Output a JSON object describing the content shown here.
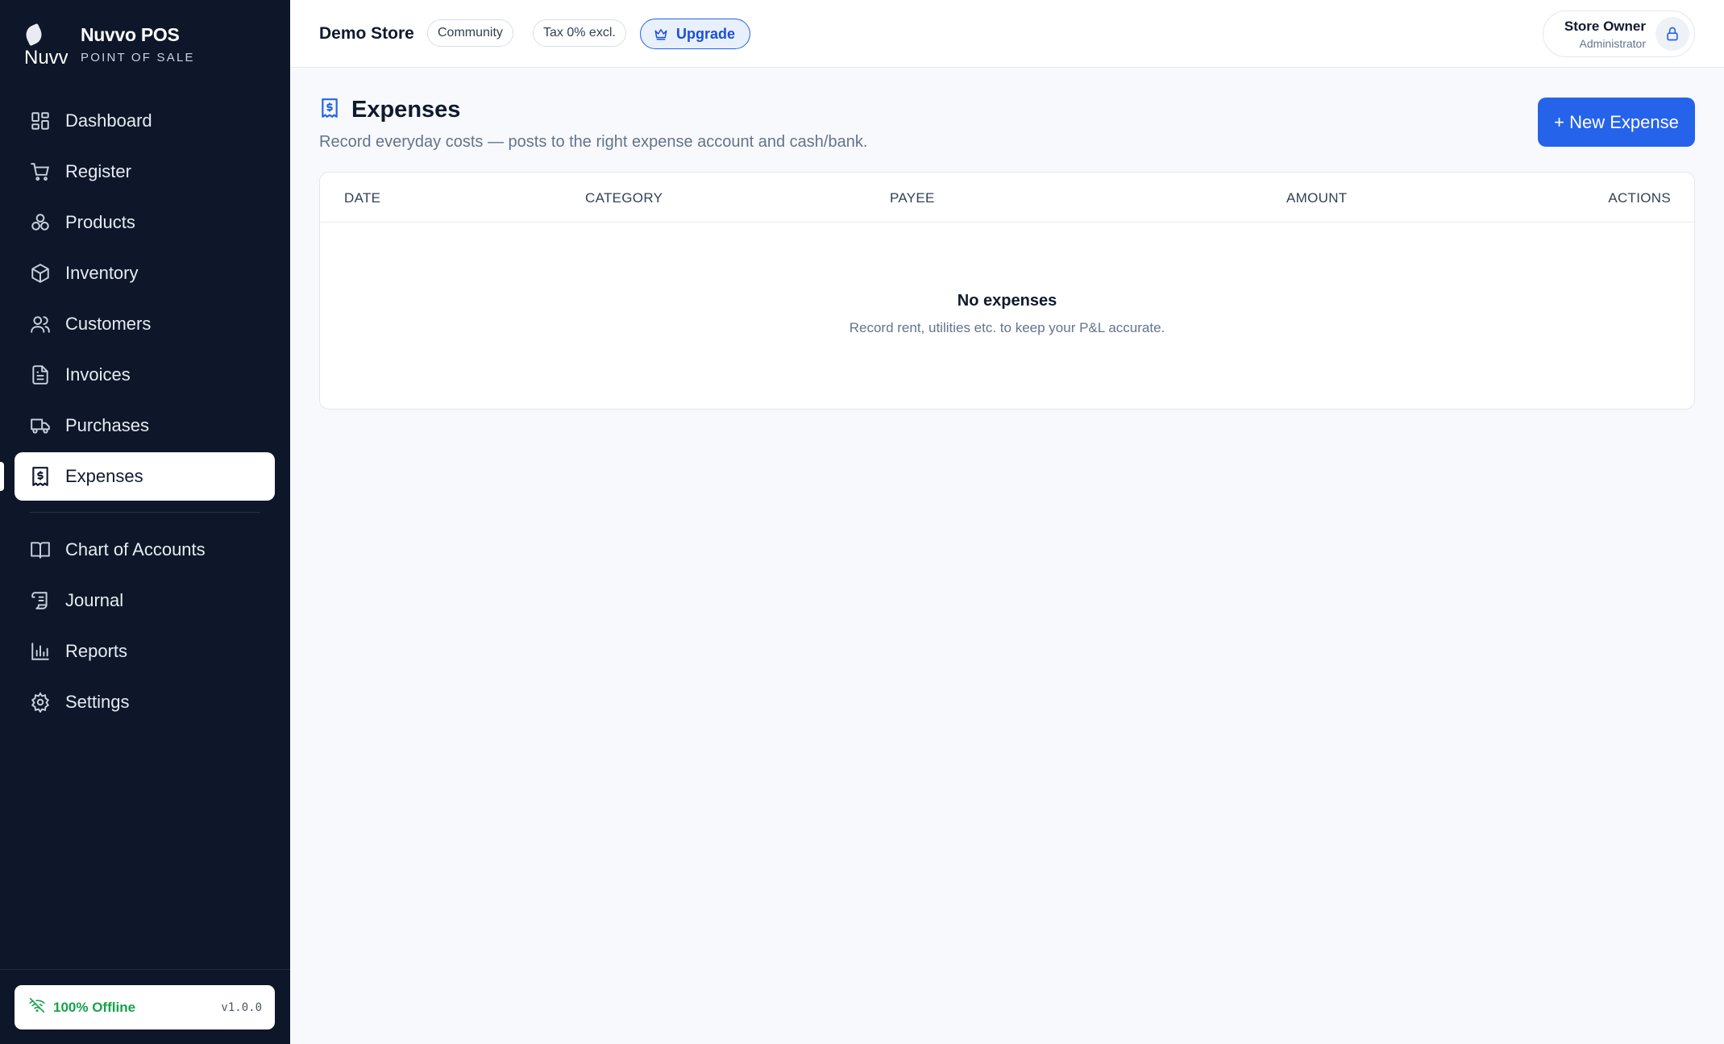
{
  "brand": {
    "logo_text": "Nuvv",
    "name": "Nuvvo POS",
    "subtitle": "POINT OF SALE"
  },
  "sidebar": {
    "items": [
      {
        "label": "Dashboard",
        "icon": "dashboard-icon"
      },
      {
        "label": "Register",
        "icon": "cart-icon"
      },
      {
        "label": "Products",
        "icon": "products-icon"
      },
      {
        "label": "Inventory",
        "icon": "box-icon"
      },
      {
        "label": "Customers",
        "icon": "users-icon"
      },
      {
        "label": "Invoices",
        "icon": "document-icon"
      },
      {
        "label": "Purchases",
        "icon": "truck-icon"
      },
      {
        "label": "Expenses",
        "icon": "receipt-dollar-icon",
        "active": true
      }
    ],
    "accounting_items": [
      {
        "label": "Chart of Accounts",
        "icon": "book-icon"
      },
      {
        "label": "Journal",
        "icon": "scroll-icon"
      },
      {
        "label": "Reports",
        "icon": "bar-chart-icon"
      },
      {
        "label": "Settings",
        "icon": "gear-icon"
      }
    ],
    "footer": {
      "status": "100% Offline",
      "version": "v1.0.0",
      "icon": "wifi-off-icon"
    }
  },
  "topbar": {
    "store": "Demo Store",
    "plan_chip": "Community",
    "tax_chip": "Tax 0% excl.",
    "upgrade_label": "Upgrade",
    "user_name": "Store Owner",
    "user_role": "Administrator"
  },
  "page": {
    "title": "Expenses",
    "subtitle": "Record everyday costs — posts to the right expense account and cash/bank.",
    "new_button": "+ New Expense"
  },
  "table": {
    "columns": [
      "DATE",
      "CATEGORY",
      "PAYEE",
      "AMOUNT",
      "ACTIONS"
    ],
    "rows": [],
    "empty_title": "No expenses",
    "empty_subtitle": "Record rent, utilities etc. to keep your P&L accurate."
  },
  "colors": {
    "sidebar_bg": "#0e1729",
    "accent": "#2563eb",
    "online": "#16a34a"
  }
}
